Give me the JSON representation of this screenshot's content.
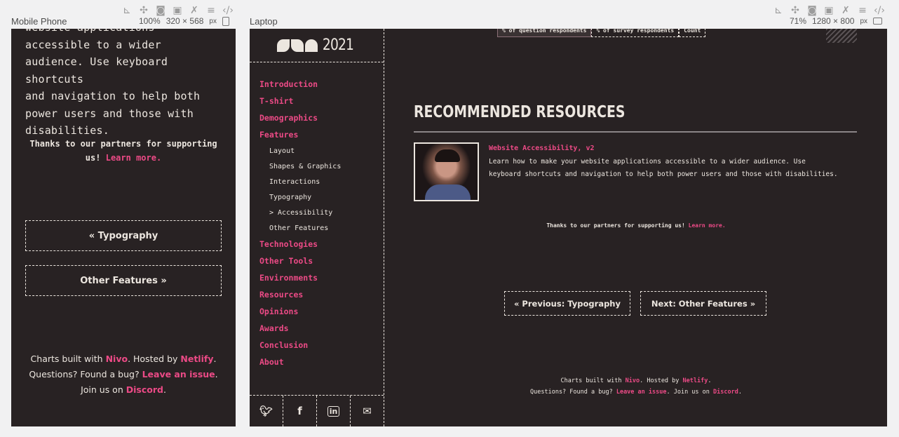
{
  "toolbar": {
    "mobile_label": "Mobile Phone",
    "laptop_label": "Laptop",
    "mobile_zoom": "100%",
    "mobile_size": "320 × 568",
    "laptop_zoom": "71%",
    "laptop_size": "1280 × 800",
    "unit": "px"
  },
  "mobile": {
    "text_lines": [
      "website applications",
      "accessible to a wider",
      "audience. Use keyboard shortcuts",
      "and navigation to help both",
      "power users and those with",
      "disabilities."
    ],
    "partners_text": "Thanks to our partners for supporting us!",
    "learn_more": "Learn more.",
    "prev_button": "« Typography",
    "next_button": "Other Features »",
    "footer": {
      "charts_prefix": "Charts built with",
      "nivo": "Nivo",
      "hosted_by": ". Hosted by",
      "netlify": "Netlify",
      "period": ".",
      "questions": "Questions? Found a bug?",
      "leave_issue": "Leave an issue",
      "join_us": ". Join us on",
      "discord": "Discord",
      "end": "."
    }
  },
  "laptop": {
    "logo_year": "2021",
    "nav": [
      {
        "label": "Introduction",
        "sub": false
      },
      {
        "label": "T-shirt",
        "sub": false
      },
      {
        "label": "Demographics",
        "sub": false
      },
      {
        "label": "Features",
        "sub": false
      },
      {
        "label": "Layout",
        "sub": true
      },
      {
        "label": "Shapes & Graphics",
        "sub": true
      },
      {
        "label": "Interactions",
        "sub": true
      },
      {
        "label": "Typography",
        "sub": true
      },
      {
        "label": "> Accessibility",
        "sub": true
      },
      {
        "label": "Other Features",
        "sub": true
      },
      {
        "label": "Technologies",
        "sub": false
      },
      {
        "label": "Other Tools",
        "sub": false
      },
      {
        "label": "Environments",
        "sub": false
      },
      {
        "label": "Resources",
        "sub": false
      },
      {
        "label": "Opinions",
        "sub": false
      },
      {
        "label": "Awards",
        "sub": false
      },
      {
        "label": "Conclusion",
        "sub": false
      },
      {
        "label": "About",
        "sub": false
      }
    ],
    "social": [
      "twitter-icon",
      "facebook-icon",
      "linkedin-icon",
      "email-icon"
    ],
    "tabs": [
      "% of question respondents",
      "% of survey respondents",
      "Count"
    ],
    "section_title": "RECOMMENDED RESOURCES",
    "resource": {
      "title": "Website Accessibility, v2",
      "description": "Learn how to make your website applications accessible to a wider audience. Use keyboard shortcuts and navigation to help both power users and those with disabilities."
    },
    "partners_text": "Thanks to our partners for supporting us!",
    "learn_more": "Learn more.",
    "prev_button": "« Previous: Typography",
    "next_button": "Next: Other Features »",
    "footer": {
      "charts_prefix": "Charts built with",
      "nivo": "Nivo",
      "hosted_by": ". Hosted by",
      "netlify": "Netlify",
      "period": ".",
      "questions": "Questions? Found a bug?",
      "leave_issue": "Leave an issue",
      "join_us": ". Join us on",
      "discord": "Discord",
      "end": "."
    },
    "colors": {
      "background": "#282223",
      "accent": "#ec4a86",
      "text": "#ece6df"
    }
  }
}
